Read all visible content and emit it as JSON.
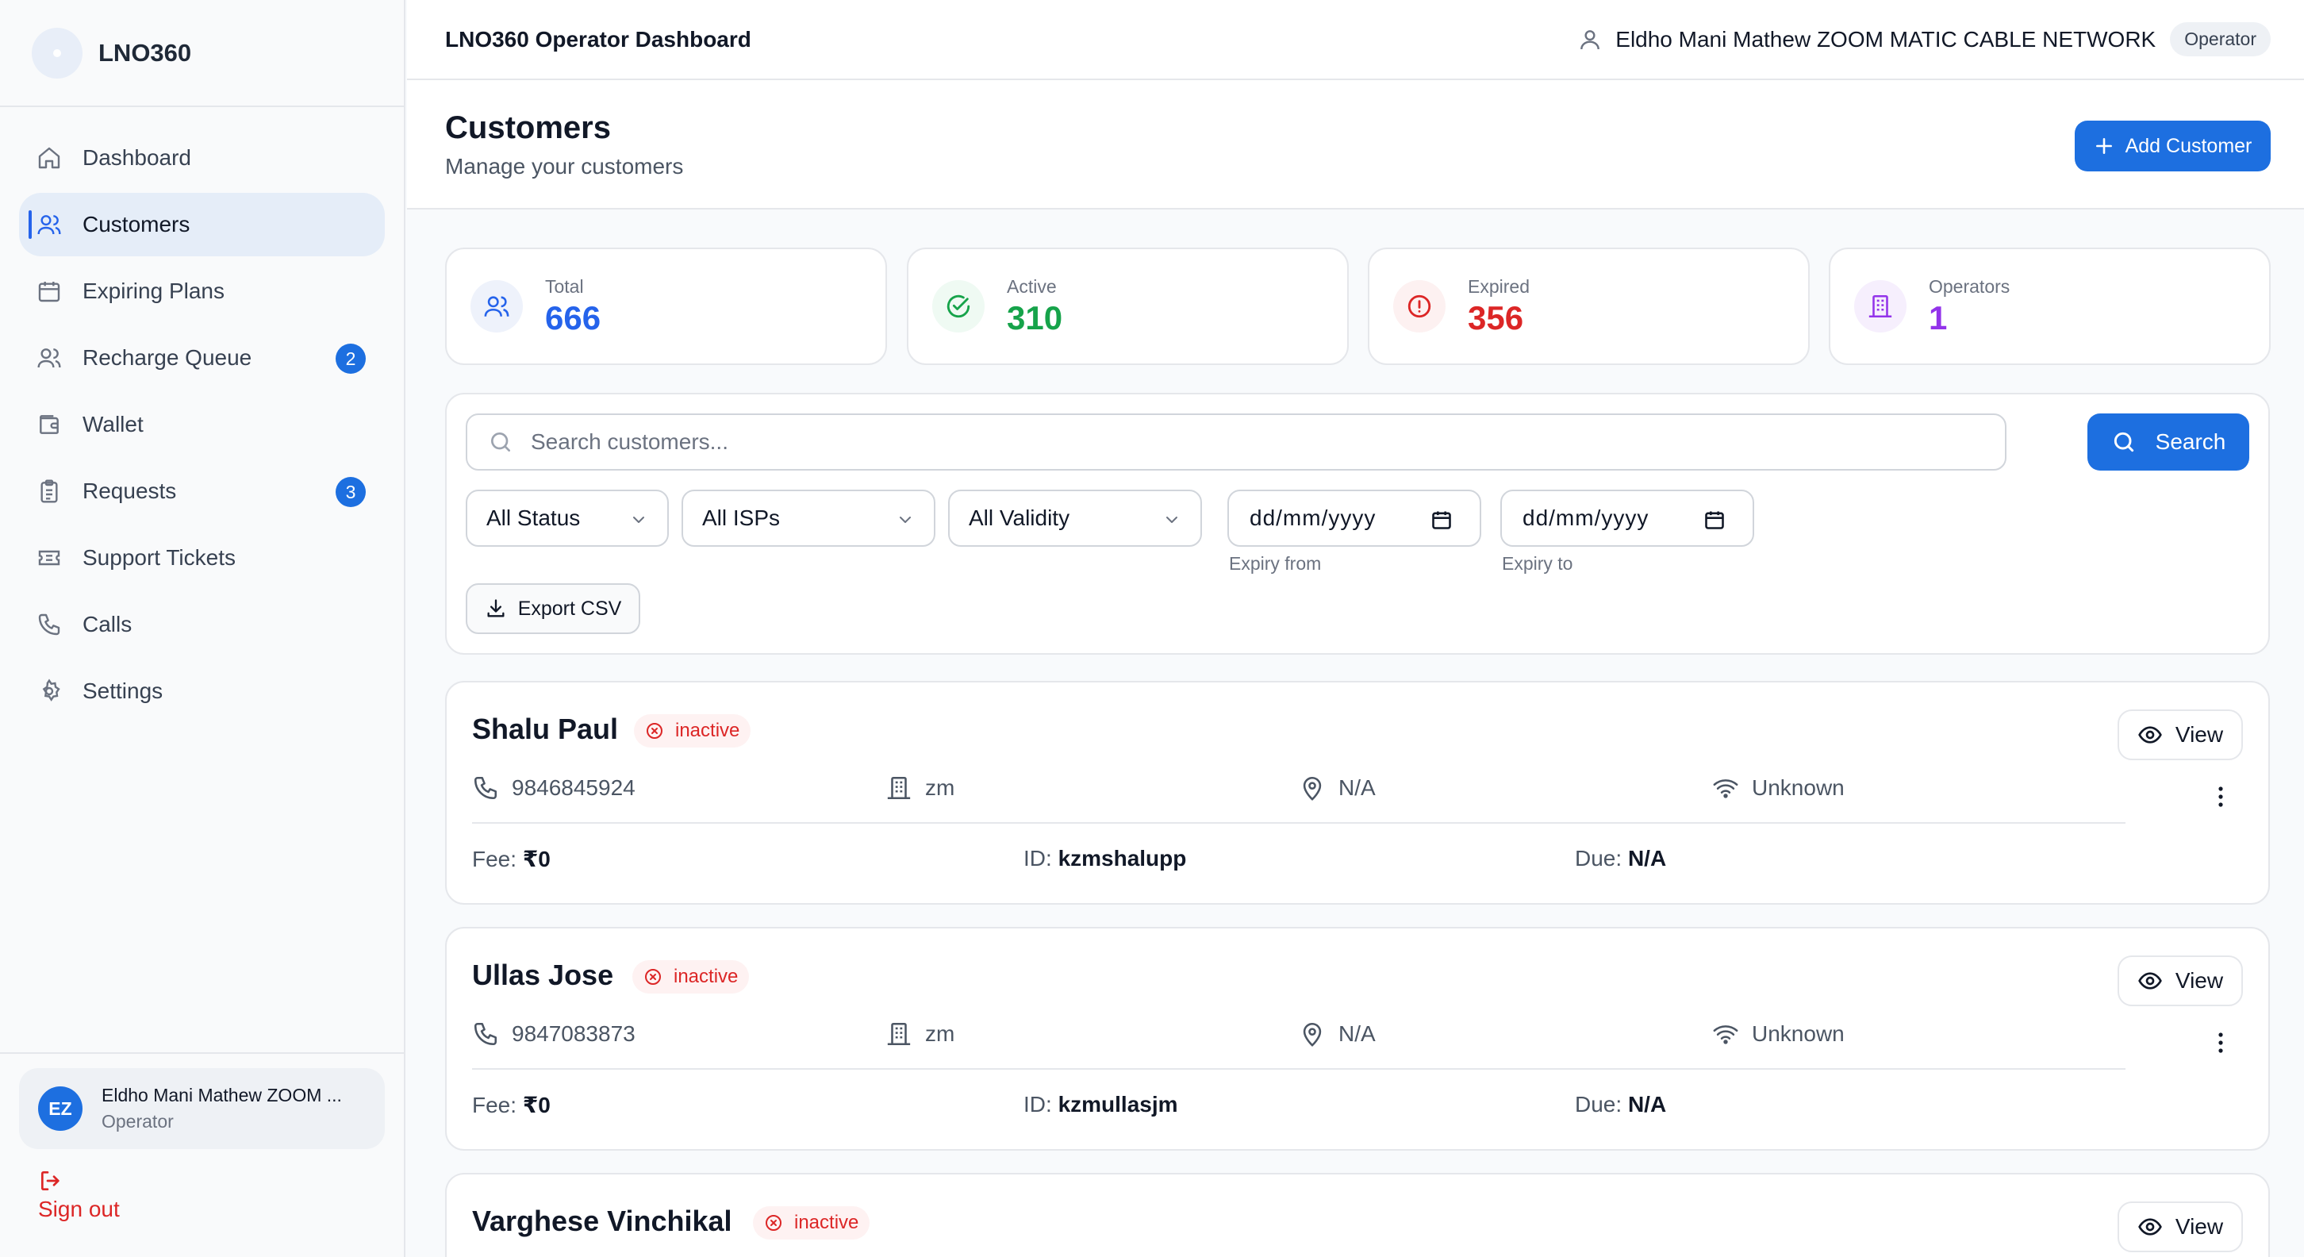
{
  "app": {
    "brand": "LNO360",
    "title": "LNO360 Operator Dashboard"
  },
  "topbar": {
    "user": "Eldho Mani Mathew ZOOM MATIC CABLE NETWORK",
    "role": "Operator"
  },
  "sidebar": {
    "items": [
      {
        "label": "Dashboard",
        "icon": "home-icon"
      },
      {
        "label": "Customers",
        "icon": "users-icon",
        "active": true
      },
      {
        "label": "Expiring Plans",
        "icon": "calendar-icon"
      },
      {
        "label": "Recharge Queue",
        "icon": "users-icon",
        "badge": "2"
      },
      {
        "label": "Wallet",
        "icon": "wallet-icon"
      },
      {
        "label": "Requests",
        "icon": "clipboard-icon",
        "badge": "3"
      },
      {
        "label": "Support Tickets",
        "icon": "ticket-icon"
      },
      {
        "label": "Calls",
        "icon": "phone-icon"
      },
      {
        "label": "Settings",
        "icon": "gear-icon"
      }
    ],
    "user": {
      "initials": "EZ",
      "name": "Eldho Mani Mathew ZOOM ...",
      "role": "Operator"
    },
    "signout": "Sign out"
  },
  "page": {
    "title": "Customers",
    "subtitle": "Manage your customers",
    "add_button": "Add Customer"
  },
  "stats": [
    {
      "label": "Total",
      "value": "666",
      "color": "#2563eb",
      "bg": "#eef2fb"
    },
    {
      "label": "Active",
      "value": "310",
      "color": "#16a34a",
      "bg": "#effaf3"
    },
    {
      "label": "Expired",
      "value": "356",
      "color": "#dc2626",
      "bg": "#fdf1f1"
    },
    {
      "label": "Operators",
      "value": "1",
      "color": "#9333ea",
      "bg": "#f6effd"
    }
  ],
  "filters": {
    "search_placeholder": "Search customers...",
    "search_button": "Search",
    "status": "All Status",
    "isps": "All ISPs",
    "validity": "All Validity",
    "date_placeholder": "dd/mm/yyyy",
    "expiry_from": "Expiry from",
    "expiry_to": "Expiry to",
    "export": "Export CSV"
  },
  "customers": [
    {
      "name": "Shalu Paul",
      "status": "inactive",
      "phone": "9846845924",
      "operator": "zm",
      "location": "N/A",
      "connection": "Unknown",
      "fee_label": "Fee:",
      "fee": "₹0",
      "id_label": "ID:",
      "id": "kzmshalupp",
      "due_label": "Due:",
      "due": "N/A",
      "view": "View"
    },
    {
      "name": "Ullas Jose",
      "status": "inactive",
      "phone": "9847083873",
      "operator": "zm",
      "location": "N/A",
      "connection": "Unknown",
      "fee_label": "Fee:",
      "fee": "₹0",
      "id_label": "ID:",
      "id": "kzmullasjm",
      "due_label": "Due:",
      "due": "N/A",
      "view": "View"
    },
    {
      "name": "Varghese Vinchikal",
      "status": "inactive",
      "view": "View"
    }
  ]
}
